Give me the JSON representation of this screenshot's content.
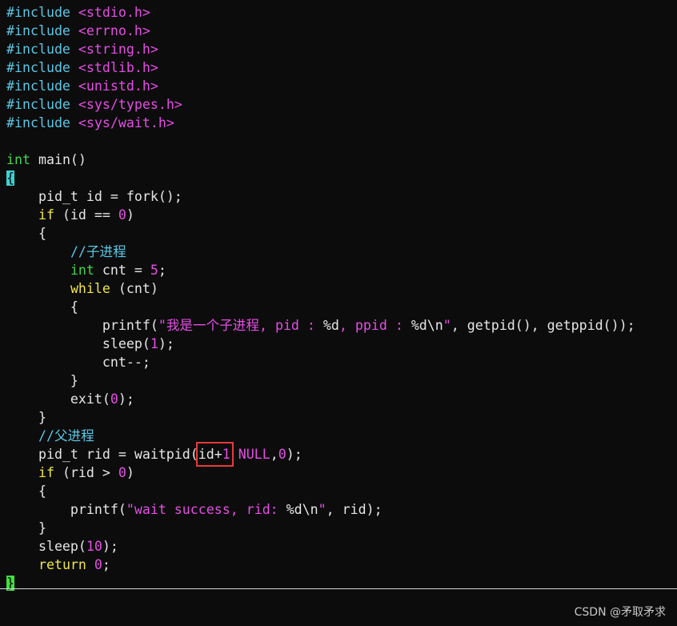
{
  "editor": {
    "lines": [
      {
        "id": "l1",
        "parts": [
          {
            "t": "#include ",
            "c": "pp"
          },
          {
            "t": "<stdio.h>",
            "c": "str"
          }
        ]
      },
      {
        "id": "l2",
        "parts": [
          {
            "t": "#include ",
            "c": "pp"
          },
          {
            "t": "<errno.h>",
            "c": "str"
          }
        ]
      },
      {
        "id": "l3",
        "parts": [
          {
            "t": "#include ",
            "c": "pp"
          },
          {
            "t": "<string.h>",
            "c": "str"
          }
        ]
      },
      {
        "id": "l4",
        "parts": [
          {
            "t": "#include ",
            "c": "pp"
          },
          {
            "t": "<stdlib.h>",
            "c": "str"
          }
        ]
      },
      {
        "id": "l5",
        "parts": [
          {
            "t": "#include ",
            "c": "pp"
          },
          {
            "t": "<unistd.h>",
            "c": "str"
          }
        ]
      },
      {
        "id": "l6",
        "parts": [
          {
            "t": "#include ",
            "c": "pp"
          },
          {
            "t": "<sys/types.h>",
            "c": "str"
          }
        ]
      },
      {
        "id": "l7",
        "parts": [
          {
            "t": "#include ",
            "c": "pp"
          },
          {
            "t": "<sys/wait.h>",
            "c": "str"
          }
        ]
      },
      {
        "id": "l8",
        "parts": []
      },
      {
        "id": "l9",
        "parts": [
          {
            "t": "int",
            "c": "ty"
          },
          {
            "t": " main()",
            "c": "plain"
          }
        ]
      },
      {
        "id": "l10",
        "parts": [
          {
            "t": "{",
            "c": "cursor"
          }
        ]
      },
      {
        "id": "l11",
        "parts": [
          {
            "t": "    pid_t id = fork();",
            "c": "plain"
          }
        ]
      },
      {
        "id": "l12",
        "parts": [
          {
            "t": "    ",
            "c": "plain"
          },
          {
            "t": "if",
            "c": "kw"
          },
          {
            "t": " (id == ",
            "c": "plain"
          },
          {
            "t": "0",
            "c": "num"
          },
          {
            "t": ")",
            "c": "plain"
          }
        ]
      },
      {
        "id": "l13",
        "parts": [
          {
            "t": "    {",
            "c": "plain"
          }
        ]
      },
      {
        "id": "l14",
        "parts": [
          {
            "t": "        ",
            "c": "plain"
          },
          {
            "t": "//子进程",
            "c": "cm"
          }
        ]
      },
      {
        "id": "l15",
        "parts": [
          {
            "t": "        ",
            "c": "plain"
          },
          {
            "t": "int",
            "c": "ty"
          },
          {
            "t": " cnt = ",
            "c": "plain"
          },
          {
            "t": "5",
            "c": "num"
          },
          {
            "t": ";",
            "c": "plain"
          }
        ]
      },
      {
        "id": "l16",
        "parts": [
          {
            "t": "        ",
            "c": "plain"
          },
          {
            "t": "while",
            "c": "kw"
          },
          {
            "t": " (cnt)",
            "c": "plain"
          }
        ]
      },
      {
        "id": "l17",
        "parts": [
          {
            "t": "        {",
            "c": "plain"
          }
        ]
      },
      {
        "id": "l18",
        "parts": [
          {
            "t": "            printf(",
            "c": "plain"
          },
          {
            "t": "\"我是一个子进程, pid : ",
            "c": "str"
          },
          {
            "t": "%d",
            "c": "plain"
          },
          {
            "t": ", ppid : ",
            "c": "str"
          },
          {
            "t": "%d\\n",
            "c": "plain"
          },
          {
            "t": "\"",
            "c": "str"
          },
          {
            "t": ", getpid(), getppid());",
            "c": "plain"
          }
        ]
      },
      {
        "id": "l19",
        "parts": [
          {
            "t": "            sleep(",
            "c": "plain"
          },
          {
            "t": "1",
            "c": "num"
          },
          {
            "t": ");",
            "c": "plain"
          }
        ]
      },
      {
        "id": "l20",
        "parts": [
          {
            "t": "            cnt--;",
            "c": "plain"
          }
        ]
      },
      {
        "id": "l21",
        "parts": [
          {
            "t": "        }",
            "c": "plain"
          }
        ]
      },
      {
        "id": "l22",
        "parts": [
          {
            "t": "        exit(",
            "c": "plain"
          },
          {
            "t": "0",
            "c": "num"
          },
          {
            "t": ");",
            "c": "plain"
          }
        ]
      },
      {
        "id": "l23",
        "parts": [
          {
            "t": "    }",
            "c": "plain"
          }
        ]
      },
      {
        "id": "l24",
        "parts": [
          {
            "t": "    ",
            "c": "plain"
          },
          {
            "t": "//父进程",
            "c": "cm"
          }
        ]
      },
      {
        "id": "l25",
        "parts": [
          {
            "t": "    pid_t rid = waitpid(id+",
            "c": "plain"
          },
          {
            "t": "1",
            "c": "num"
          },
          {
            "t": " ",
            "c": "plain"
          },
          {
            "t": "NULL",
            "c": "str"
          },
          {
            "t": ",",
            "c": "plain"
          },
          {
            "t": "0",
            "c": "num"
          },
          {
            "t": ");",
            "c": "plain"
          }
        ]
      },
      {
        "id": "l26",
        "parts": [
          {
            "t": "    ",
            "c": "plain"
          },
          {
            "t": "if",
            "c": "kw"
          },
          {
            "t": " (rid > ",
            "c": "plain"
          },
          {
            "t": "0",
            "c": "num"
          },
          {
            "t": ")",
            "c": "plain"
          }
        ]
      },
      {
        "id": "l27",
        "parts": [
          {
            "t": "    {",
            "c": "plain"
          }
        ]
      },
      {
        "id": "l28",
        "parts": [
          {
            "t": "        printf(",
            "c": "plain"
          },
          {
            "t": "\"wait success, rid: ",
            "c": "str"
          },
          {
            "t": "%d\\n",
            "c": "plain"
          },
          {
            "t": "\"",
            "c": "str"
          },
          {
            "t": ", rid);",
            "c": "plain"
          }
        ]
      },
      {
        "id": "l29",
        "parts": [
          {
            "t": "    }",
            "c": "plain"
          }
        ]
      },
      {
        "id": "l30",
        "parts": [
          {
            "t": "    sleep(",
            "c": "plain"
          },
          {
            "t": "10",
            "c": "num"
          },
          {
            "t": ");",
            "c": "plain"
          }
        ]
      },
      {
        "id": "l31",
        "parts": [
          {
            "t": "    ",
            "c": "plain"
          },
          {
            "t": "return",
            "c": "kw"
          },
          {
            "t": " ",
            "c": "plain"
          },
          {
            "t": "0",
            "c": "num"
          },
          {
            "t": ";",
            "c": "plain"
          }
        ]
      },
      {
        "id": "l32",
        "parts": [
          {
            "t": "}",
            "c": "cursor-green"
          }
        ]
      }
    ]
  },
  "watermark": {
    "text": "CSDN @矛取矛求"
  },
  "colors": {
    "background": "#0c0c0c",
    "preprocessor": "#5ac8e6",
    "string": "#e44ee4",
    "keyword": "#f0e64a",
    "type": "#3fd84a",
    "highlight_box": "#e83a3a"
  }
}
